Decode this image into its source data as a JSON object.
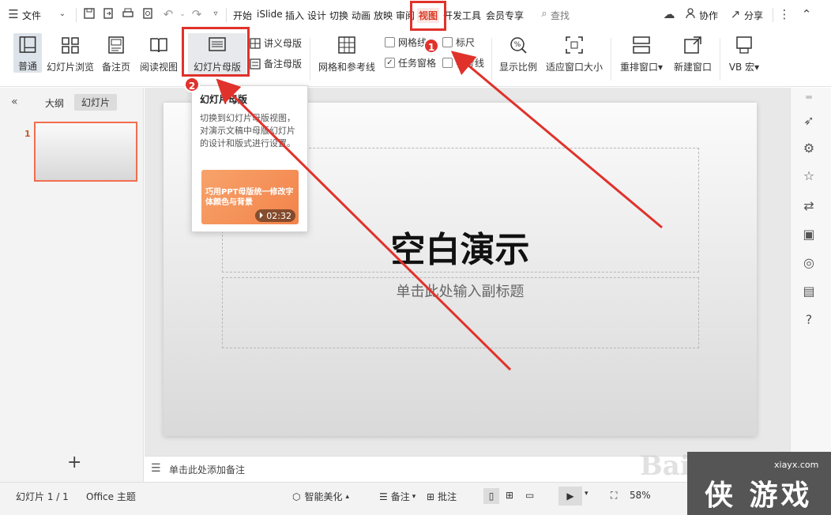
{
  "menubar": {
    "menu_label": "文件",
    "tabs": [
      "开始",
      "iSlide",
      "插入",
      "设计",
      "切换",
      "动画",
      "放映",
      "审阅",
      "视图",
      "开发工具",
      "会员专享"
    ],
    "search": "查找",
    "collab": "协作",
    "share": "分享"
  },
  "ribbon": {
    "normal": "普通",
    "sorter": "幻灯片浏览",
    "notes_page": "备注页",
    "reading": "阅读视图",
    "slide_master": "幻灯片母版",
    "handout_master": "讲义母版",
    "notes_master": "备注母版",
    "grid_guides": "网格和参考线",
    "gridlines": "网格线",
    "ruler": "标尺",
    "task_pane": "任务窗格",
    "guides": "参考线",
    "zoom": "显示比例",
    "fit": "适应窗口大小",
    "arrange": "重排窗口",
    "new_window": "新建窗口",
    "vb": "VB 宏"
  },
  "leftpanel": {
    "tab_outline": "大纲",
    "tab_slides": "幻灯片",
    "slide_number": "1",
    "add_icon": "+"
  },
  "slide": {
    "title": "空白演示",
    "subtitle": "单击此处输入副标题"
  },
  "notes": {
    "placeholder": "单击此处添加备注"
  },
  "tooltip": {
    "title": "幻灯片母版",
    "desc": "切换到幻灯片母版视图，对演示文稿中母版幻灯片的设计和版式进行设置。",
    "video_caption": "巧用PPT母版统一修改字体颜色与背景",
    "duration": "02:32"
  },
  "statusbar": {
    "slide_info": "幻灯片 1 / 1",
    "theme": "Office 主题",
    "beautify": "智能美化",
    "notes": "备注",
    "comments": "批注",
    "zoom": "58%"
  },
  "annotations": {
    "badge1": "1",
    "badge2": "2"
  },
  "watermark": {
    "baidu": "Baidu 经验",
    "site": "xiayx.com",
    "brand": "侠 游戏"
  },
  "colors": {
    "accent": "#d93b24",
    "annotation": "#e0322b",
    "thumb_border": "#f26d4f"
  }
}
